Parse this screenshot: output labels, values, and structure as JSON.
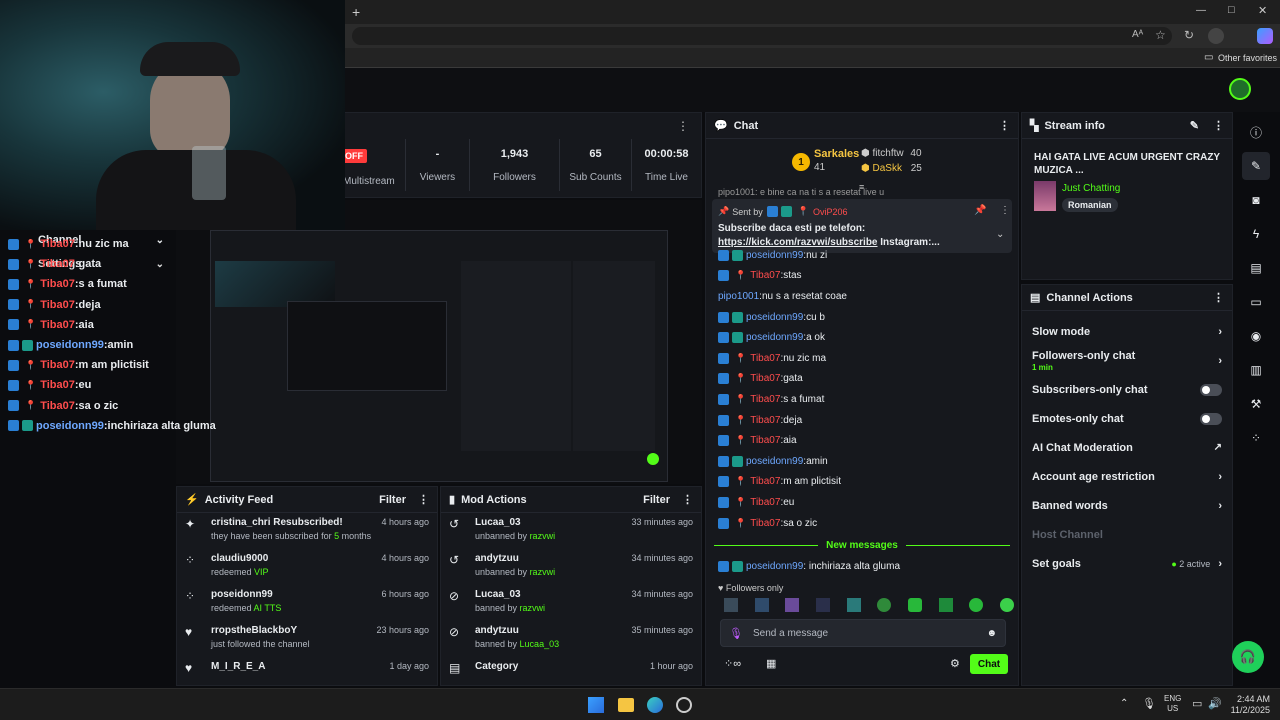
{
  "browser": {
    "new_tab_glyph": "+",
    "window_controls": [
      "—",
      "□",
      "✕"
    ],
    "other_favorites": "Other favorites"
  },
  "stats": {
    "offline_badge": "OFF",
    "multistream": "Multistream",
    "viewers_value": "-",
    "viewers_label": "Viewers",
    "followers_value": "1,943",
    "followers_label": "Followers",
    "subs_value": "65",
    "subs_label": "Sub Counts",
    "time_value": "00:00:58",
    "time_label": "Time Live"
  },
  "chat": {
    "title": "Chat",
    "leaderboard": {
      "rank": "1",
      "top_user": "Sarkales",
      "top_count": "41",
      "user2": "fitchftw",
      "user2_count": "40",
      "user3": "DaSkk",
      "user3_count": "25"
    },
    "partial_top": "pipo1001: e bine ca na ti s a resetat live u",
    "pinned": {
      "sent_by": "Sent by",
      "sender": "OviP206",
      "line1": "Subscribe daca esti pe telefon:",
      "link": "https://kick.com/razvwi/subscribe",
      "tail": " Instagram:..."
    },
    "messages": [
      {
        "user": "poseidonn99",
        "text": "nu zi",
        "color": "blue",
        "badges": 2,
        "pin": false
      },
      {
        "user": "Tiba07",
        "text": "stas",
        "color": "red",
        "badges": 1,
        "pin": true
      },
      {
        "user": "pipo1001",
        "text": "nu s a resetat coae",
        "color": "blue",
        "badges": 0,
        "pin": false
      },
      {
        "user": "poseidonn99",
        "text": "cu b",
        "color": "blue",
        "badges": 2,
        "pin": false
      },
      {
        "user": "poseidonn99",
        "text": "a ok",
        "color": "blue",
        "badges": 2,
        "pin": false
      },
      {
        "user": "Tiba07",
        "text": "nu zic ma",
        "color": "red",
        "badges": 1,
        "pin": true
      },
      {
        "user": "Tiba07",
        "text": "gata",
        "color": "red",
        "badges": 1,
        "pin": true
      },
      {
        "user": "Tiba07",
        "text": "s a fumat",
        "color": "red",
        "badges": 1,
        "pin": true
      },
      {
        "user": "Tiba07",
        "text": "deja",
        "color": "red",
        "badges": 1,
        "pin": true
      },
      {
        "user": "Tiba07",
        "text": "aia",
        "color": "red",
        "badges": 1,
        "pin": true
      },
      {
        "user": "poseidonn99",
        "text": "amin",
        "color": "blue",
        "badges": 2,
        "pin": false
      },
      {
        "user": "Tiba07",
        "text": "m am plictisit",
        "color": "red",
        "badges": 1,
        "pin": true
      },
      {
        "user": "Tiba07",
        "text": "eu",
        "color": "red",
        "badges": 1,
        "pin": true
      },
      {
        "user": "Tiba07",
        "text": "sa o zic",
        "color": "red",
        "badges": 1,
        "pin": true
      }
    ],
    "new_messages": "New messages",
    "last_message": {
      "user": "poseidonn99",
      "text": "inchiriaza alta gluma"
    },
    "followers_only": "Followers only",
    "input_placeholder": "Send a message",
    "send_button": "Chat"
  },
  "stream_info": {
    "title": "Stream info",
    "stream_title": "HAI  GATA  LIVE  ACUM  URGENT  CRAZY  MUZICA ...",
    "category": "Just Chatting",
    "language": "Romanian"
  },
  "channel_actions": {
    "title": "Channel Actions",
    "items": [
      {
        "label": "Slow mode",
        "control": "chevron"
      },
      {
        "label": "Followers-only chat",
        "sub": "1 min",
        "control": "chevron"
      },
      {
        "label": "Subscribers-only chat",
        "control": "toggle"
      },
      {
        "label": "Emotes-only chat",
        "control": "toggle"
      },
      {
        "label": "AI Chat Moderation",
        "control": "external"
      },
      {
        "label": "Account age restriction",
        "control": "chevron"
      },
      {
        "label": "Banned words",
        "control": "chevron"
      },
      {
        "label": "Host Channel",
        "control": "none",
        "disabled": true
      },
      {
        "label": "Set goals",
        "extra": "2 active",
        "control": "chevron"
      }
    ]
  },
  "activity_feed": {
    "title": "Activity Feed",
    "filter": "Filter",
    "items": [
      {
        "icon": "sparkle-icon",
        "name": "cristina_chri",
        "action": " Resubscribed!",
        "detail": "they have been subscribed for ",
        "highlight": "5",
        "detail_tail": " months",
        "time": "4 hours ago"
      },
      {
        "icon": "kicks-icon",
        "name": "claudiu9000",
        "action": "",
        "detail": "redeemed ",
        "highlight": "VIP",
        "detail_tail": "",
        "time": "4 hours ago"
      },
      {
        "icon": "kicks-icon",
        "name": "poseidonn99",
        "action": "",
        "detail": "redeemed ",
        "highlight": "AI TTS",
        "detail_tail": "",
        "time": "6 hours ago"
      },
      {
        "icon": "heart-icon",
        "name": "rropstheBlackboY",
        "action": "",
        "detail": "just followed the channel",
        "highlight": "",
        "detail_tail": "",
        "time": "23 hours ago"
      },
      {
        "icon": "heart-icon",
        "name": "M_I_R_E_A",
        "action": "",
        "detail": "",
        "highlight": "",
        "detail_tail": "",
        "time": "1 day ago"
      }
    ]
  },
  "mod_actions": {
    "title": "Mod Actions",
    "filter": "Filter",
    "items": [
      {
        "icon": "undo-icon",
        "name": "Lucaa_03",
        "detail": "unbanned by ",
        "by": "razvwi",
        "time": "33 minutes ago"
      },
      {
        "icon": "undo-icon",
        "name": "andytzuu",
        "detail": "unbanned by ",
        "by": "razvwi",
        "time": "34 minutes ago"
      },
      {
        "icon": "ban-icon",
        "name": "Lucaa_03",
        "detail": "banned by ",
        "by": "razvwi",
        "time": "34 minutes ago"
      },
      {
        "icon": "ban-icon",
        "name": "andytzuu",
        "detail": "banned by ",
        "by": "Lucaa_03",
        "time": "35 minutes ago"
      },
      {
        "icon": "category-icon",
        "name": "Category",
        "detail": "",
        "by": "",
        "time": "1 hour ago"
      }
    ]
  },
  "overlay": {
    "channel": "Channel",
    "settings": "Settings",
    "lines": [
      {
        "user": "Tiba07",
        "text": "nu zic ma",
        "kind": "red"
      },
      {
        "user": "Tiba07",
        "text": "gata",
        "kind": "red"
      },
      {
        "user": "Tiba07",
        "text": "s a fumat",
        "kind": "red"
      },
      {
        "user": "Tiba07",
        "text": "deja",
        "kind": "red"
      },
      {
        "user": "Tiba07",
        "text": "aia",
        "kind": "red"
      },
      {
        "user": "poseidonn99",
        "text": "amin",
        "kind": "blue"
      },
      {
        "user": "Tiba07",
        "text": "m am plictisit",
        "kind": "red"
      },
      {
        "user": "Tiba07",
        "text": "eu",
        "kind": "red"
      },
      {
        "user": "Tiba07",
        "text": "sa o zic",
        "kind": "red"
      },
      {
        "user": "poseidonn99",
        "text": "inchiriaza alta gluma",
        "kind": "blue"
      }
    ]
  },
  "taskbar": {
    "lang": "ENG",
    "region": "US",
    "time": "2:44 AM",
    "date": "11/2/2025"
  },
  "colors": {
    "kick_green": "#53fc18",
    "name_red": "#ff4d4d",
    "name_blue": "#6ea8ff"
  }
}
